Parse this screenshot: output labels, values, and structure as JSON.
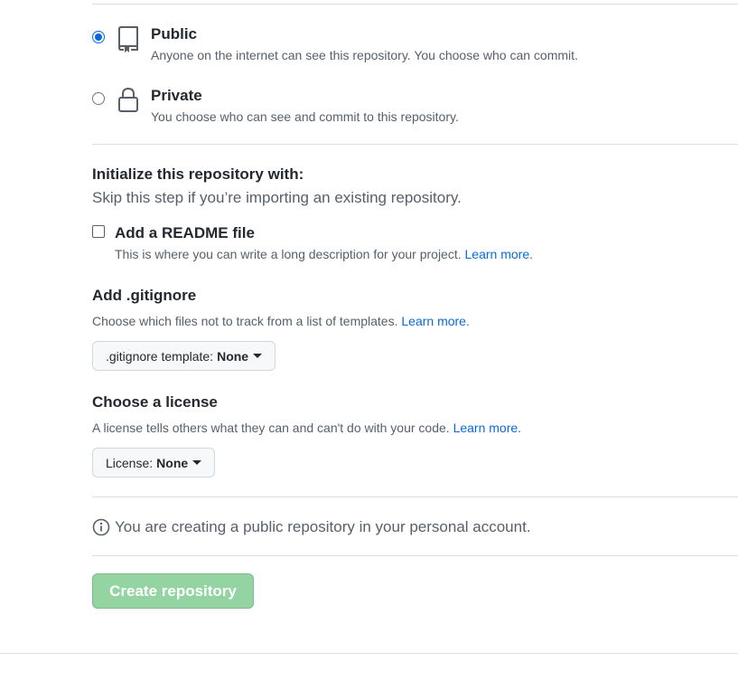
{
  "visibility": {
    "public": {
      "title": "Public",
      "description": "Anyone on the internet can see this repository. You choose who can commit.",
      "checked": true,
      "icon": "repo-icon"
    },
    "private": {
      "title": "Private",
      "description": "You choose who can see and commit to this repository.",
      "checked": false,
      "icon": "lock-icon"
    }
  },
  "initialize": {
    "title": "Initialize this repository with:",
    "subtitle": "Skip this step if you’re importing an existing repository.",
    "readme": {
      "label": "Add a README file",
      "description": "This is where you can write a long description for your project.",
      "link": "Learn more.",
      "checked": false
    }
  },
  "gitignore": {
    "title": "Add .gitignore",
    "description": "Choose which files not to track from a list of templates.",
    "link": "Learn more.",
    "select_label": ".gitignore template:",
    "select_value": "None"
  },
  "license": {
    "title": "Choose a license",
    "description": "A license tells others what they can and can't do with your code.",
    "link": "Learn more.",
    "select_label": "License:",
    "select_value": "None"
  },
  "notice": {
    "icon": "info-icon",
    "text": "You are creating a public repository in your personal account."
  },
  "submit": {
    "label": "Create repository",
    "color": "#94d3a2"
  }
}
